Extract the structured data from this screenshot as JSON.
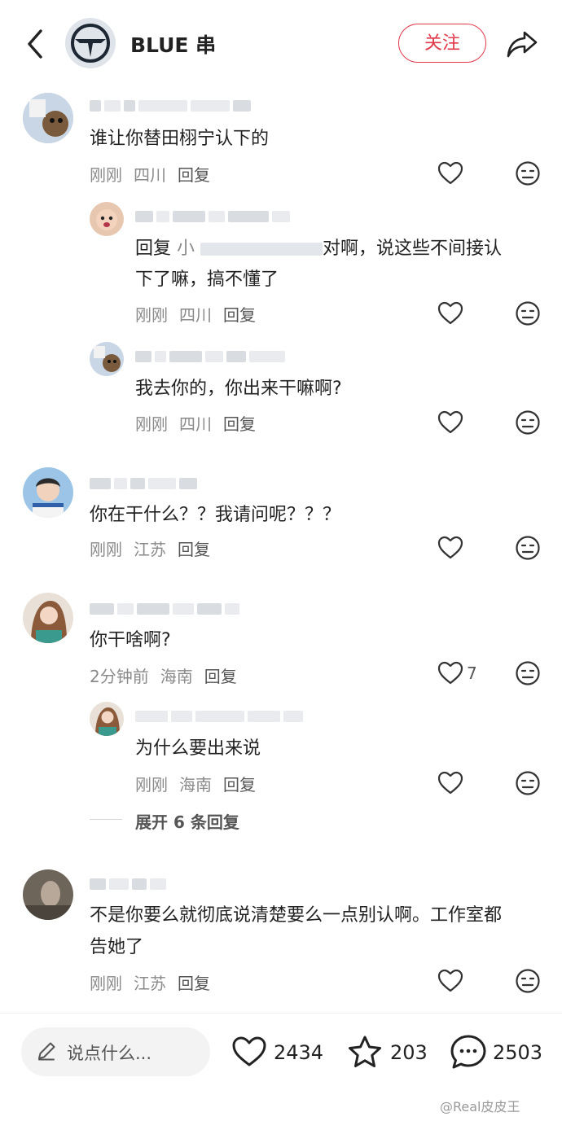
{
  "header": {
    "title": "BLUE 串",
    "follow_label": "关注"
  },
  "comments": [
    {
      "text": "谁让你替田栩宁认下的",
      "time": "刚刚",
      "location": "四川",
      "reply_label": "回复"
    },
    {
      "reply_prefix": "回复",
      "reply_target": "小",
      "text_line1": "对啊，说这些不间接认",
      "text_line2": "下了嘛，搞不懂了",
      "time": "刚刚",
      "location": "四川",
      "reply_label": "回复"
    },
    {
      "text": "我去你的，你出来干嘛啊?",
      "time": "刚刚",
      "location": "四川",
      "reply_label": "回复"
    },
    {
      "text": "你在干什么？？我请问呢？？？",
      "time": "刚刚",
      "location": "江苏",
      "reply_label": "回复"
    },
    {
      "text": "你干啥啊?",
      "time": "2分钟前",
      "location": "海南",
      "reply_label": "回复",
      "like_count": "7"
    },
    {
      "text": "为什么要出来说",
      "time": "刚刚",
      "location": "海南",
      "reply_label": "回复"
    },
    {
      "text_line1": "不是你要么就彻底说清楚要么一点别认啊。工作室都",
      "text_line2": "告她了",
      "time": "刚刚",
      "location": "江苏",
      "reply_label": "回复"
    }
  ],
  "expand_label": "展开 6 条回复",
  "bottom_bar": {
    "input_placeholder": "说点什么...",
    "likes": "2434",
    "favorites": "203",
    "comments": "2503"
  },
  "watermark": "@Real皮皮王",
  "colors": {
    "accent": "#e2384a",
    "muted": "#8a8a8a"
  },
  "icons": [
    "back-icon",
    "share-icon",
    "heart-icon",
    "meh-face-icon",
    "star-icon",
    "chat-bubble-icon",
    "pencil-icon"
  ]
}
